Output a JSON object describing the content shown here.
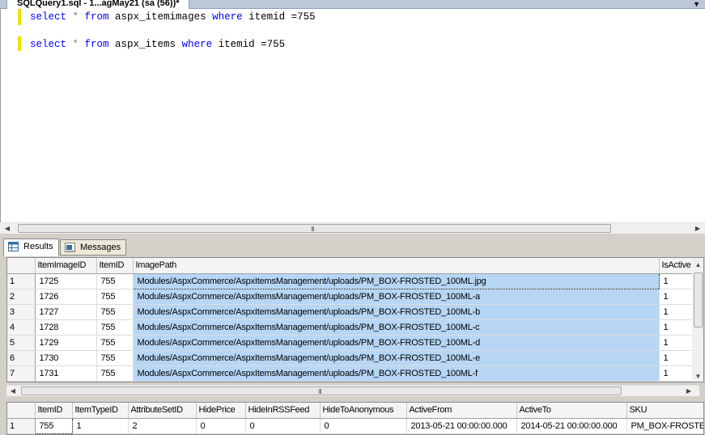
{
  "tab": {
    "title": "SQLQuery1.sql - 1...agMay21 (sa (56))*",
    "dropdown_glyph": "▼"
  },
  "editor": {
    "lines": [
      {
        "kw1": "select",
        "star": " * ",
        "kw2": "from",
        "tbl": " aspx_itemimages ",
        "kw3": "where",
        "cond": " itemid =755"
      },
      {
        "kw1": "select",
        "star": " * ",
        "kw2": "from",
        "tbl": " aspx_items ",
        "kw3": "where",
        "cond": " itemid =755"
      }
    ],
    "scroll_grip": "III"
  },
  "results_tabs": {
    "results_label": "Results",
    "messages_label": "Messages"
  },
  "grid1": {
    "columns": [
      "ItemImageID",
      "ItemID",
      "ImagePath",
      "IsActive"
    ],
    "rows": [
      {
        "n": "1",
        "id": "1725",
        "item": "755",
        "path": "Modules/AspxCommerce/AspxItemsManagement/uploads/PM_BOX-FROSTED_100ML.jpg",
        "active": "1"
      },
      {
        "n": "2",
        "id": "1726",
        "item": "755",
        "path": "Modules/AspxCommerce/AspxItemsManagement/uploads/PM_BOX-FROSTED_100ML-a",
        "active": "1"
      },
      {
        "n": "3",
        "id": "1727",
        "item": "755",
        "path": "Modules/AspxCommerce/AspxItemsManagement/uploads/PM_BOX-FROSTED_100ML-b",
        "active": "1"
      },
      {
        "n": "4",
        "id": "1728",
        "item": "755",
        "path": "Modules/AspxCommerce/AspxItemsManagement/uploads/PM_BOX-FROSTED_100ML-c",
        "active": "1"
      },
      {
        "n": "5",
        "id": "1729",
        "item": "755",
        "path": "Modules/AspxCommerce/AspxItemsManagement/uploads/PM_BOX-FROSTED_100ML-d",
        "active": "1"
      },
      {
        "n": "6",
        "id": "1730",
        "item": "755",
        "path": "Modules/AspxCommerce/AspxItemsManagement/uploads/PM_BOX-FROSTED_100ML-e",
        "active": "1"
      },
      {
        "n": "7",
        "id": "1731",
        "item": "755",
        "path": "Modules/AspxCommerce/AspxItemsManagement/uploads/PM_BOX-FROSTED_100ML-f",
        "active": "1"
      }
    ]
  },
  "grid2": {
    "columns": [
      "ItemID",
      "ItemTypeID",
      "AttributeSetID",
      "HidePrice",
      "HideInRSSFeed",
      "HideToAnonymous",
      "ActiveFrom",
      "ActiveTo",
      "SKU"
    ],
    "rows": [
      {
        "n": "1",
        "ItemID": "755",
        "ItemTypeID": "1",
        "AttributeSetID": "2",
        "HidePrice": "0",
        "HideInRSSFeed": "0",
        "HideToAnonymous": "0",
        "ActiveFrom": "2013-05-21 00:00:00.000",
        "ActiveTo": "2014-05-21 00:00:00.000",
        "SKU": "PM_BOX-FROSTE"
      }
    ]
  },
  "colors": {
    "keyword": "#0000ff",
    "operator": "#808080",
    "selection": "#b7d6f5",
    "change_marker": "#f0e000"
  }
}
